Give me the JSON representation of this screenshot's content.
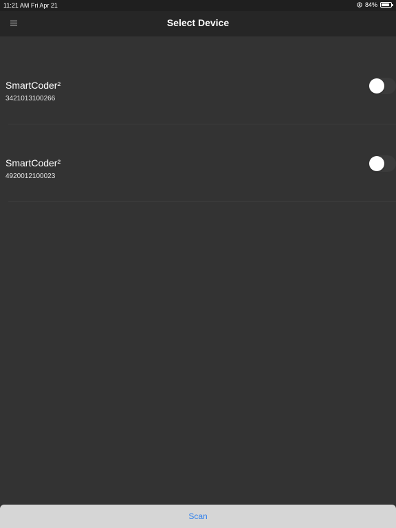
{
  "status_bar": {
    "time_date": "11:21 AM   Fri Apr 21",
    "battery_percent": "84%",
    "battery_level": 0.84,
    "lock_icon": "rotation-lock-icon",
    "battery_icon": "battery-icon"
  },
  "nav": {
    "title": "Select Device",
    "menu_icon": "hamburger-menu-icon"
  },
  "devices": [
    {
      "name": "SmartCoder²",
      "serial": "3421013100266",
      "enabled": false
    },
    {
      "name": "SmartCoder²",
      "serial": "4920012100023",
      "enabled": false
    }
  ],
  "scan": {
    "label": "Scan",
    "color": "#2f80ed"
  },
  "colors": {
    "background": "#333333",
    "nav_background": "#262626",
    "scan_background": "#d6d6d6"
  }
}
